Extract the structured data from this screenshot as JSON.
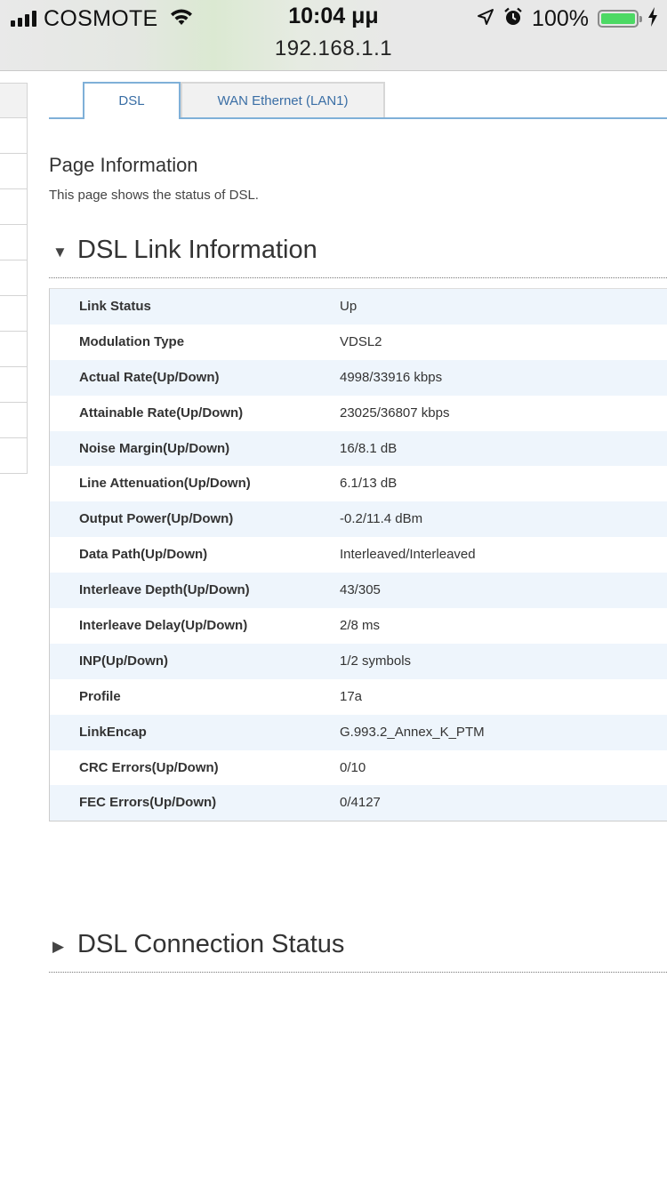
{
  "status_bar": {
    "carrier": "COSMOTE",
    "time": "10:04 μμ",
    "url": "192.168.1.1",
    "battery_percent": "100%",
    "battery_level": 1.0,
    "battery_color": "#4cd964",
    "icons": [
      "signal-icon",
      "wifi-icon",
      "location-arrow-icon",
      "alarm-icon",
      "battery-icon",
      "charging-bolt-icon"
    ]
  },
  "tabs": [
    {
      "label": "DSL",
      "active": true
    },
    {
      "label": "WAN Ethernet (LAN1)",
      "active": false
    }
  ],
  "page_info": {
    "title": "Page Information",
    "description": "This page shows the status of DSL."
  },
  "sections": {
    "link_info": {
      "title": "DSL Link Information",
      "expanded": true,
      "arrow": "▼"
    },
    "connection_status": {
      "title": "DSL Connection Status",
      "expanded": false,
      "arrow": "▶"
    }
  },
  "link_table": [
    {
      "label": "Link Status",
      "value": "Up"
    },
    {
      "label": "Modulation Type",
      "value": "VDSL2"
    },
    {
      "label": "Actual Rate(Up/Down)",
      "value": "4998/33916 kbps"
    },
    {
      "label": "Attainable Rate(Up/Down)",
      "value": "23025/36807 kbps"
    },
    {
      "label": "Noise Margin(Up/Down)",
      "value": "16/8.1 dB"
    },
    {
      "label": "Line Attenuation(Up/Down)",
      "value": "6.1/13 dB"
    },
    {
      "label": "Output Power(Up/Down)",
      "value": "-0.2/11.4 dBm"
    },
    {
      "label": "Data Path(Up/Down)",
      "value": "Interleaved/Interleaved"
    },
    {
      "label": "Interleave Depth(Up/Down)",
      "value": "43/305"
    },
    {
      "label": "Interleave Delay(Up/Down)",
      "value": "2/8 ms"
    },
    {
      "label": "INP(Up/Down)",
      "value": "1/2 symbols"
    },
    {
      "label": "Profile",
      "value": "17a"
    },
    {
      "label": "LinkEncap",
      "value": "G.993.2_Annex_K_PTM"
    },
    {
      "label": "CRC Errors(Up/Down)",
      "value": "0/10"
    },
    {
      "label": "FEC Errors(Up/Down)",
      "value": "0/4127"
    }
  ],
  "colors": {
    "tab_accent": "#7fb0d8",
    "tab_text": "#3a6ea5",
    "row_stripe": "#eef5fc"
  }
}
